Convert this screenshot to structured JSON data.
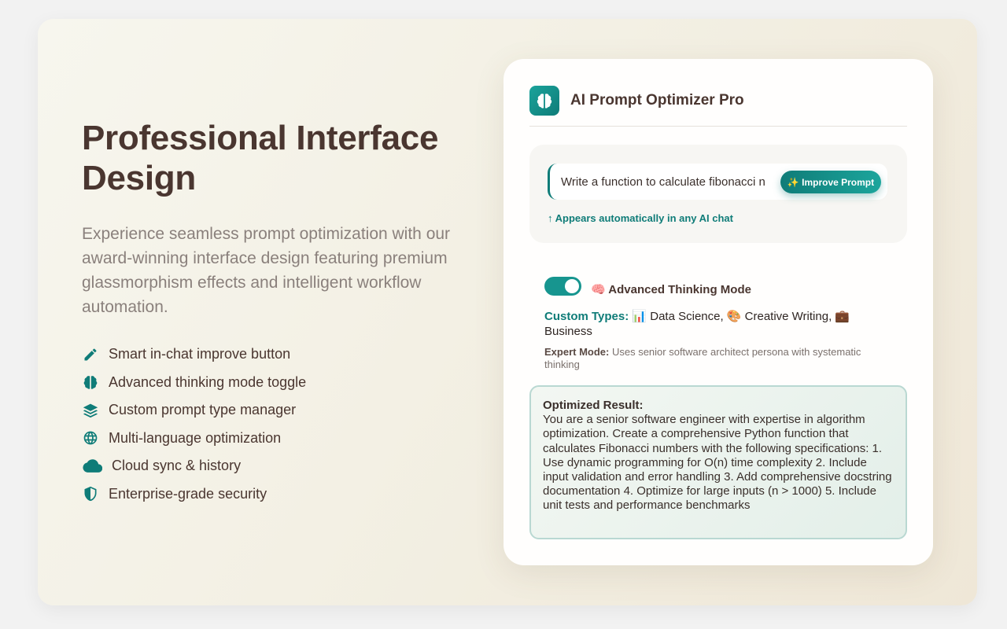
{
  "hero": {
    "headline": "Professional Interface Design",
    "description": "Experience seamless prompt optimization with our award-winning interface design featuring premium glassmorphism effects and intelligent workflow automation."
  },
  "features": [
    {
      "label": "Smart in-chat improve button",
      "icon": "pencil-icon"
    },
    {
      "label": "Advanced thinking mode toggle",
      "icon": "brain-icon"
    },
    {
      "label": "Custom prompt type manager",
      "icon": "layers-icon"
    },
    {
      "label": "Multi-language optimization",
      "icon": "globe-icon"
    },
    {
      "label": "Cloud sync & history",
      "icon": "cloud-icon"
    },
    {
      "label": "Enterprise-grade security",
      "icon": "shield-icon"
    }
  ],
  "panel": {
    "title": "AI Prompt Optimizer Pro",
    "input_text": "Write a function to calculate fibonacci n",
    "improve_button": "✨ Improve Prompt",
    "hint": "↑ Appears automatically in any AI chat",
    "thinking_mode": {
      "label": "🧠 Advanced Thinking Mode",
      "enabled": true
    },
    "custom_types": {
      "label": "Custom Types:",
      "value": "📊 Data Science, 🎨 Creative Writing, 💼 Business"
    },
    "expert_mode": {
      "label": "Expert Mode:",
      "value": "Uses senior software architect persona with systematic thinking"
    },
    "result": {
      "label": "Optimized Result:",
      "text": "You are a senior software engineer with expertise in algorithm optimization. Create a comprehensive Python function that calculates Fibonacci numbers with the following specifications: 1. Use dynamic programming for O(n) time complexity 2. Include input validation and error handling 3. Add comprehensive docstring documentation 4. Optimize for large inputs (n > 1000) 5. Include unit tests and performance benchmarks"
    }
  },
  "colors": {
    "accent": "#0f7c78",
    "heading": "#4a3630",
    "muted": "#8a807c"
  }
}
